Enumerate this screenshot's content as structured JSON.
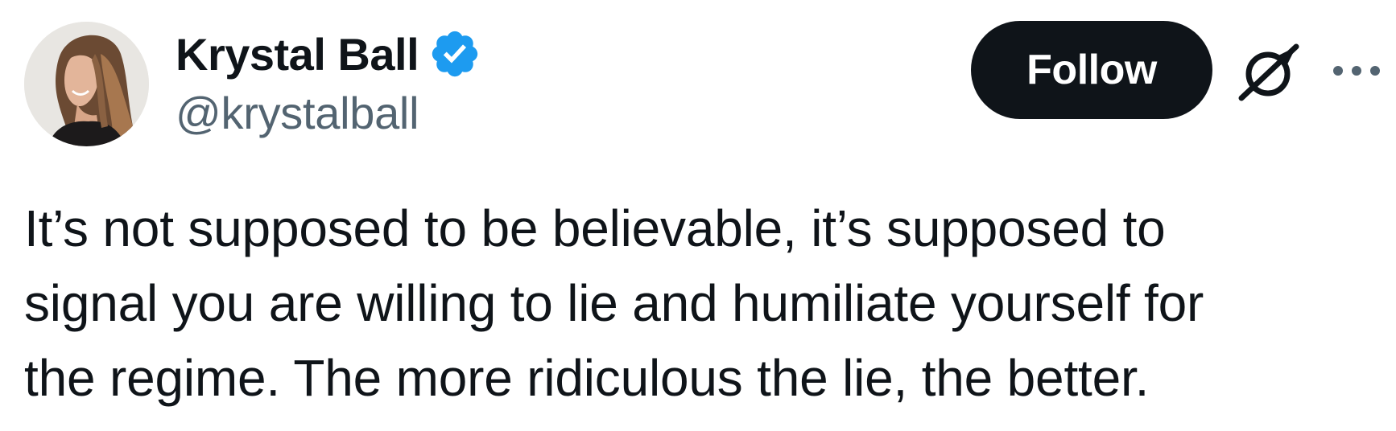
{
  "author": {
    "display_name": "Krystal Ball",
    "handle": "@krystalball",
    "verified": true,
    "verified_color": "#1d9bf0",
    "avatar_icon": "profile-photo"
  },
  "actions": {
    "follow_label": "Follow",
    "follow_bg": "#0f1419",
    "grok_icon": "grok-icon",
    "more_icon": "more-horizontal-icon"
  },
  "tweet": {
    "lines": [
      "It’s not supposed to be believable, it’s supposed to",
      "signal you are willing to lie and humiliate yourself for",
      "the regime. The more ridiculous the lie, the better."
    ]
  }
}
